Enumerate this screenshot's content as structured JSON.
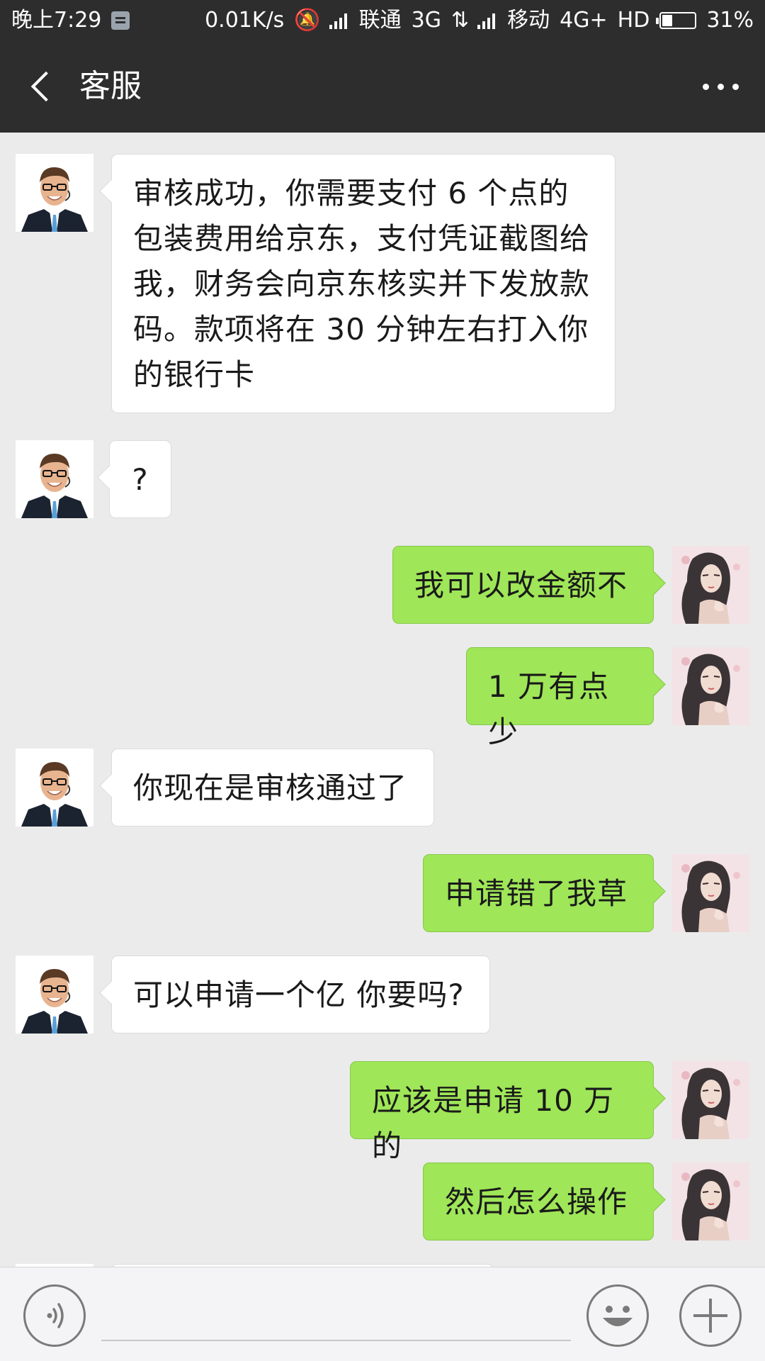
{
  "status_bar": {
    "time": "晚上7:29",
    "net_speed": "0.01K/s",
    "carrier1": "联通",
    "net1": "3G",
    "carrier2": "移动",
    "net2": "4G+",
    "hd": "HD",
    "battery_percent": "31%",
    "battery_level": 0.31
  },
  "header": {
    "title": "客服"
  },
  "messages": [
    {
      "side": "left",
      "text": "审核成功，你需要支付 6 个点的包装费用给京东，支付凭证截图给我，财务会向京东核实并下发放款码。款项将在 30 分钟左右打入你的银行卡"
    },
    {
      "side": "left",
      "text": "?"
    },
    {
      "side": "right",
      "text": "我可以改金额不"
    },
    {
      "side": "right",
      "text": "1 万有点少"
    },
    {
      "side": "left",
      "text": "你现在是审核通过了"
    },
    {
      "side": "right",
      "text": "申请错了我草"
    },
    {
      "side": "left",
      "text": "可以申请一个亿 你要吗?"
    },
    {
      "side": "right",
      "text": "应该是申请 10 万的"
    },
    {
      "side": "right",
      "text": "然后怎么操作"
    }
  ],
  "input_bar": {
    "voice_icon": "voice-icon",
    "emoji_icon": "emoji-icon",
    "plus_icon": "plus-icon",
    "placeholder": ""
  },
  "colors": {
    "header_bg": "#2d2d2d",
    "chat_bg": "#ebebeb",
    "bubble_in": "#ffffff",
    "bubble_out": "#9fe658"
  }
}
